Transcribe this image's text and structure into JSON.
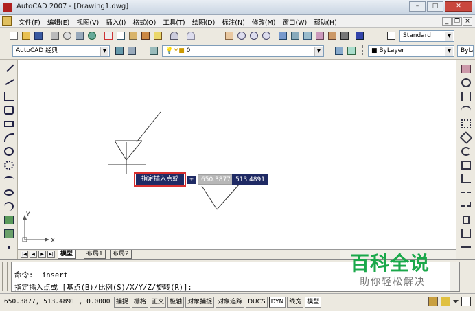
{
  "window": {
    "title": "AutoCAD 2007 - [Drawing1.dwg]",
    "controls": {
      "minimize": "–",
      "maximize": "□",
      "close": "✕"
    }
  },
  "menubar": {
    "items": [
      "文件(F)",
      "编辑(E)",
      "视图(V)",
      "插入(I)",
      "格式(O)",
      "工具(T)",
      "绘图(D)",
      "标注(N)",
      "修改(M)",
      "窗口(W)",
      "帮助(H)"
    ],
    "mdi_controls": {
      "minimize": "_",
      "restore": "❐",
      "close": "×"
    }
  },
  "toolbar1": {
    "text_style_combo": "Standard"
  },
  "toolbar2": {
    "workspace_combo": "AutoCAD 经典",
    "layer_combo": "0",
    "color_combo": "ByLayer",
    "linetype_combo": "ByLayer"
  },
  "canvas": {
    "insert_prompt": "指定插入点或",
    "prompt_glyph": "±",
    "coord_x": "650.3877",
    "coord_y": "513.4891",
    "ucs_x_label": "X",
    "ucs_y_label": "Y"
  },
  "layout_tabs": {
    "nav": [
      "|◀",
      "◀",
      "▶",
      "▶|"
    ],
    "tabs": [
      "模型",
      "布局1",
      "布局2"
    ],
    "active": 0
  },
  "command": {
    "history_line": "命令: _insert",
    "current_prompt": "指定插入点或 [基点(B)/比例(S)/X/Y/Z/旋转(R)]:"
  },
  "watermark": {
    "main": "百科全说",
    "sub": "助你轻松解决"
  },
  "statusbar": {
    "coords": "650.3877,  513.4891 , 0.0000",
    "toggles": [
      {
        "label": "捕捉",
        "on": false
      },
      {
        "label": "栅格",
        "on": false
      },
      {
        "label": "正交",
        "on": false
      },
      {
        "label": "极轴",
        "on": false
      },
      {
        "label": "对象捕捉",
        "on": false
      },
      {
        "label": "对象追踪",
        "on": false
      },
      {
        "label": "DUCS",
        "on": false
      },
      {
        "label": "DYN",
        "on": true
      },
      {
        "label": "线宽",
        "on": false
      },
      {
        "label": "模型",
        "on": true
      }
    ]
  },
  "colors": {
    "titlebar": "#c8d4e2",
    "prompt_bg": "#1f2a64",
    "prompt_border": "#d83030",
    "watermark_green": "#1aa84a"
  }
}
